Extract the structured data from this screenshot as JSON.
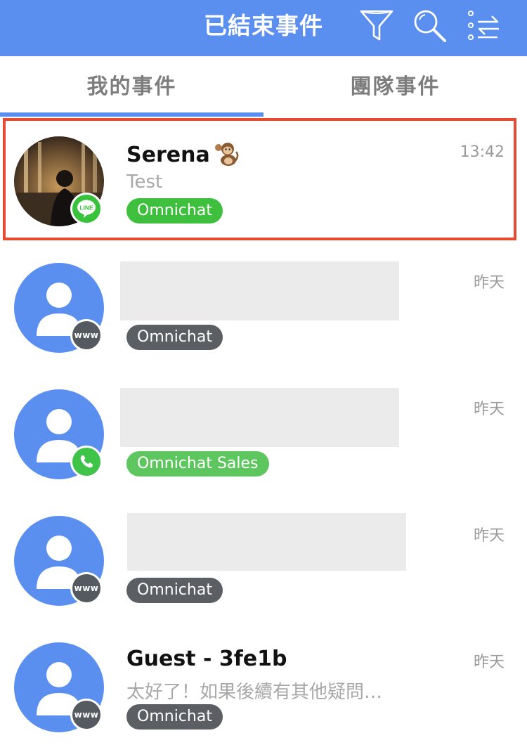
{
  "header": {
    "title": "已結束事件",
    "icons": [
      "filter-icon",
      "search-icon",
      "sort-settings-icon"
    ],
    "color": "#5a8ff0"
  },
  "tabs": [
    {
      "label": "我的事件",
      "active": true
    },
    {
      "label": "團隊事件",
      "active": false
    }
  ],
  "conversations": [
    {
      "name": "Serena",
      "emoji": "monkey",
      "preview": "Test",
      "time": "13:42",
      "tag": "Omnichat",
      "tag_color": "#3ebf3e",
      "channel": "line-icon",
      "channel_label": "LINE",
      "selected": true
    },
    {
      "name": "",
      "preview": "",
      "time": "昨天",
      "tag": "Omnichat",
      "tag_color": "#5b5e63",
      "channel": "web-icon",
      "channel_label": "www",
      "redacted": true
    },
    {
      "name": "",
      "preview": "",
      "time": "昨天",
      "tag": "Omnichat Sales",
      "tag_color": "#5ec65e",
      "channel": "whatsapp-icon",
      "redacted": true
    },
    {
      "name": "",
      "preview": "",
      "time": "昨天",
      "tag": "Omnichat",
      "tag_color": "#5b5e63",
      "channel": "web-icon",
      "channel_label": "www",
      "redacted": true
    },
    {
      "name": "Guest - 3fe1b",
      "preview": "太好了！如果後續有其他疑問…",
      "time": "昨天",
      "tag": "Omnichat",
      "tag_color": "#5b5e63",
      "channel": "web-icon",
      "channel_label": "www"
    }
  ]
}
